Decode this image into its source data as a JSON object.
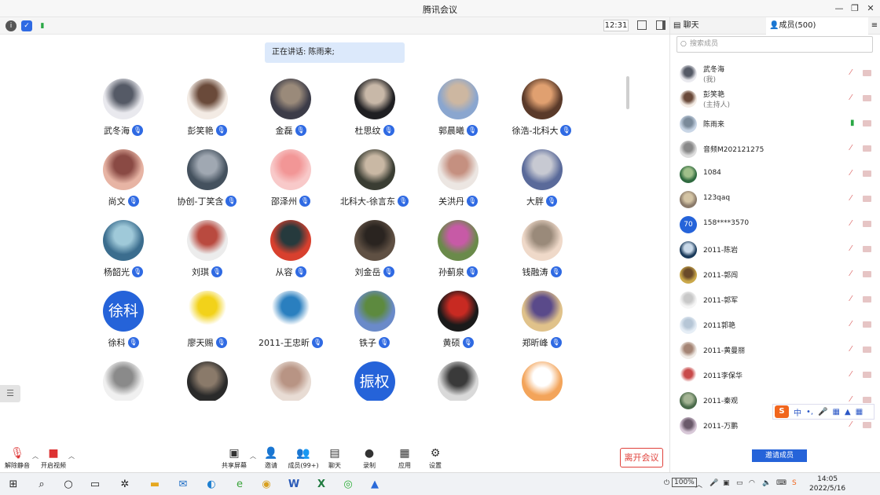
{
  "window": {
    "title": "腾讯会议"
  },
  "topbar": {
    "time": "12:31"
  },
  "speaking": "正在讲话: 陈雨来;",
  "participants": [
    {
      "name": "武冬海",
      "c1": "#e9e9ee",
      "c2": "#555a66"
    },
    {
      "name": "彭笑艳",
      "c1": "#f3ebe4",
      "c2": "#6a4a3a"
    },
    {
      "name": "金磊",
      "c1": "#3c3c48",
      "c2": "#9a8a7a"
    },
    {
      "name": "杜思纹",
      "c1": "#1f1f22",
      "c2": "#c8b8a8"
    },
    {
      "name": "郭晨曦",
      "c1": "#8aa6cf",
      "c2": "#cdb7a1"
    },
    {
      "name": "徐浩-北科大",
      "c1": "#5a3a2a",
      "c2": "#e0a070"
    },
    {
      "name": "尚文",
      "c1": "#e7b4a4",
      "c2": "#8a4a44"
    },
    {
      "name": "协创-丁笑含",
      "c1": "#44515e",
      "c2": "#a0a8b2"
    },
    {
      "name": "邵泽州",
      "c1": "#f8c9c9",
      "c2": "#f29696"
    },
    {
      "name": "北科大-徐言东",
      "c1": "#3a3d33",
      "c2": "#c9b8a4"
    },
    {
      "name": "关洪丹",
      "c1": "#ece6e2",
      "c2": "#c59080"
    },
    {
      "name": "大胖",
      "c1": "#5a6a9a",
      "c2": "#c7c9d2"
    },
    {
      "name": "杨韶光",
      "c1": "#3b6d8e",
      "c2": "#9fc9d9"
    },
    {
      "name": "刘琪",
      "c1": "#ececec",
      "c2": "#b94a3f"
    },
    {
      "name": "从容",
      "c1": "#d8402e",
      "c2": "#263a3d"
    },
    {
      "name": "刘金岳",
      "c1": "#5f5043",
      "c2": "#2a2420"
    },
    {
      "name": "孙蓟泉",
      "c1": "#6a8a4a",
      "c2": "#c75aa6"
    },
    {
      "name": "钱融涛",
      "c1": "#efd9c9",
      "c2": "#9a8a7a"
    },
    {
      "name": "徐科",
      "text": "徐科",
      "color": "#2563d9"
    },
    {
      "name": "廖天赐",
      "c1": "#ffffff",
      "c2": "#f2d21a"
    },
    {
      "name": "2011-王忠昕",
      "c1": "#ffffff",
      "c2": "#2a7fbf"
    },
    {
      "name": "铁子",
      "c1": "#6a8ac9",
      "c2": "#5d8a3f"
    },
    {
      "name": "黄硕",
      "c1": "#1a1a1a",
      "c2": "#c82a22"
    },
    {
      "name": "郑昕峰",
      "c1": "#e0c28a",
      "c2": "#5a4a8a"
    },
    {
      "name": "",
      "c1": "#f0f0f0",
      "c2": "#8a8a8a"
    },
    {
      "name": "",
      "c1": "#2a2a2a",
      "c2": "#8a7a6a"
    },
    {
      "name": "",
      "c1": "#e8dcd4",
      "c2": "#b89484"
    },
    {
      "name": "",
      "text": "振权",
      "color": "#2563d9"
    },
    {
      "name": "",
      "c1": "#d9d9d9",
      "c2": "#3a3a3a"
    },
    {
      "name": "",
      "c1": "#f3a45a",
      "c2": "#ffffff"
    }
  ],
  "toolbar": {
    "unmute": "解除静音",
    "start_video": "开启视频",
    "share": "共享屏幕",
    "invite": "邀请",
    "members": "成员(99+)",
    "chat": "聊天",
    "record": "录制",
    "apps": "应用",
    "settings": "设置",
    "leave": "离开会议"
  },
  "panel": {
    "tab_chat": "聊天",
    "tab_members": "成员(500)",
    "search_placeholder": "搜索成员",
    "members": [
      {
        "name": "武冬海",
        "role": "(我)",
        "c1": "#e9e9ee",
        "c2": "#555a66"
      },
      {
        "name": "彭笑艳",
        "role": "(主持人)",
        "c1": "#f3ebe4",
        "c2": "#6a4a3a"
      },
      {
        "name": "陈雨来",
        "c1": "#c9d6e6",
        "c2": "#7a8a9a"
      },
      {
        "name": "音频M202121275",
        "c1": "#ddd",
        "c2": "#888"
      },
      {
        "name": "1084",
        "c1": "#2f6a3f",
        "c2": "#9fbf8a"
      },
      {
        "name": "123qaq",
        "c1": "#8a7a6a",
        "c2": "#d4c4a4"
      },
      {
        "name": "158****3570",
        "text": "70",
        "color": "#2563d9"
      },
      {
        "name": "2011-陈岩",
        "c1": "#1a3a5a",
        "c2": "#c9d9e9"
      },
      {
        "name": "2011-郭闯",
        "c1": "#caa84a",
        "c2": "#6a4a2a"
      },
      {
        "name": "2011-郭军",
        "c1": "#f5f5f5",
        "c2": "#c8c8c8"
      },
      {
        "name": "2011郭艳",
        "c1": "#e6eef6",
        "c2": "#b6c6d6"
      },
      {
        "name": "2011-黄曼丽",
        "c1": "#f0ebe6",
        "c2": "#a48474"
      },
      {
        "name": "2011李保华",
        "c1": "#ffffff",
        "c2": "#c84a4a"
      },
      {
        "name": "2011-秦观",
        "c1": "#4a6a4a",
        "c2": "#a4b494"
      },
      {
        "name": "2011-万鹏",
        "c1": "#d8c8d8",
        "c2": "#6a5a6a"
      }
    ],
    "invite_btn": "邀请成员"
  },
  "ime": {
    "lang": "中"
  },
  "taskbar": {
    "battery": "100%",
    "time": "14:05",
    "date": "2022/5/16"
  }
}
